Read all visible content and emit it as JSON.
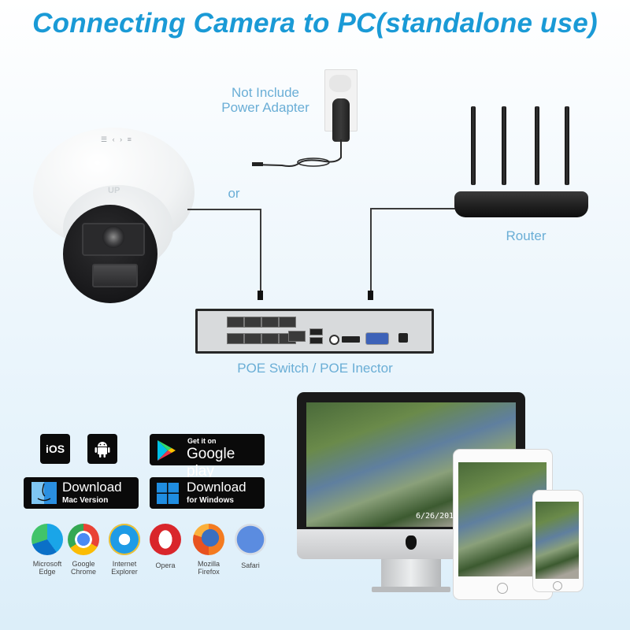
{
  "title": "Connecting Camera to PC(standalone use)",
  "labels": {
    "power_adapter_line1": "Not Include",
    "power_adapter_line2": "Power Adapter",
    "or": "or",
    "router": "Router",
    "poe_switch": "POE Switch / POE Inector"
  },
  "camera": {
    "top_marking": "☰ ‹ › ≡",
    "brand_mark": "UP"
  },
  "apps": {
    "ios": "iOS",
    "android_icon": "android-icon",
    "google_play": {
      "small": "Get it on",
      "large": "Google play"
    },
    "mac": {
      "large": "Download",
      "small": "Mac Version"
    },
    "windows": {
      "large": "Download",
      "small": "for Windows"
    }
  },
  "browsers": [
    {
      "icon": "edge-icon",
      "line1": "Microsoft",
      "line2": "Edge"
    },
    {
      "icon": "chrome-icon",
      "line1": "Google",
      "line2": "Chrome"
    },
    {
      "icon": "ie-icon",
      "line1": "Internet",
      "line2": "Explorer"
    },
    {
      "icon": "opera-icon",
      "line1": "Opera",
      "line2": ""
    },
    {
      "icon": "firefox-icon",
      "line1": "Mozilla",
      "line2": "Firefox"
    },
    {
      "icon": "safari-icon",
      "line1": "Safari",
      "line2": ""
    }
  ],
  "monitor": {
    "timestamp": "6/26/2019"
  },
  "colors": {
    "title": "#1a9ad6",
    "label": "#6aaed6"
  }
}
